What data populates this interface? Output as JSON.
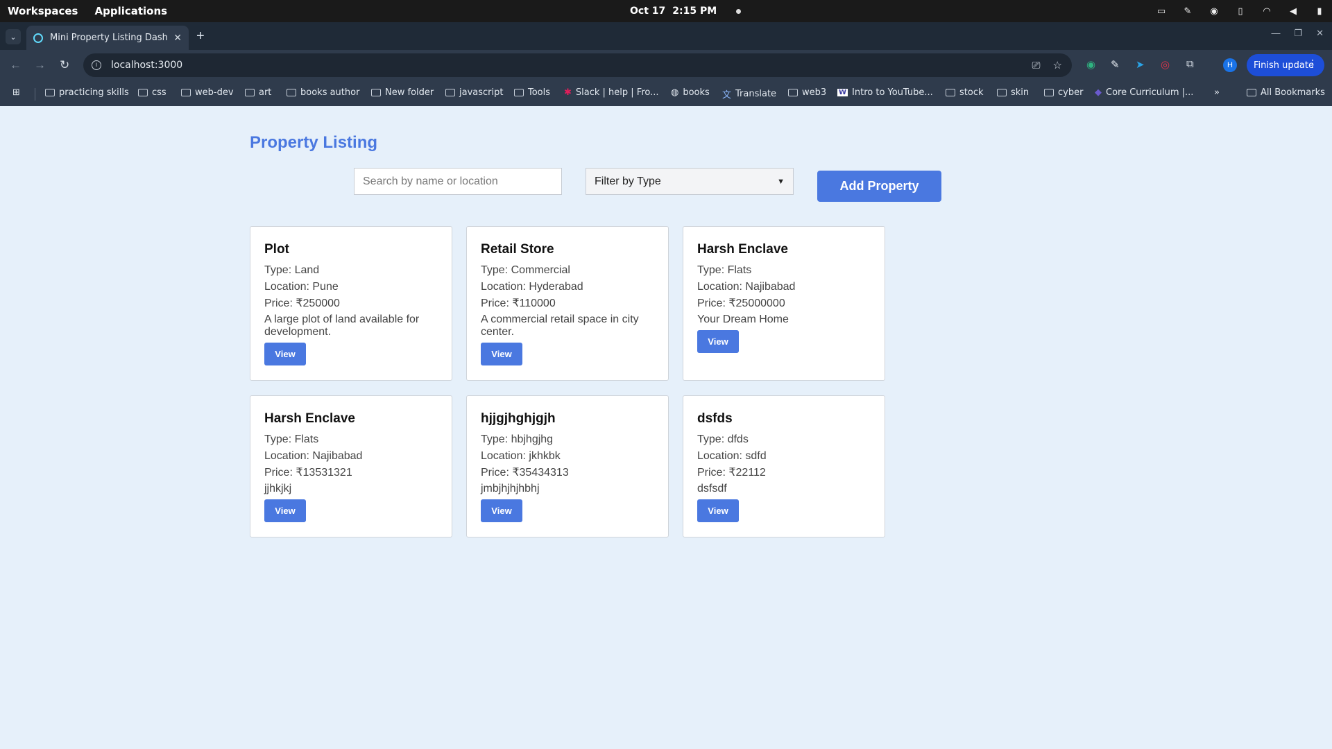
{
  "os": {
    "workspaces": "Workspaces",
    "applications": "Applications",
    "date": "Oct 17",
    "time": "2:15 PM"
  },
  "browser": {
    "tab_title": "Mini Property Listing Dashboard",
    "url": "localhost:3000",
    "avatar_letter": "H",
    "finish_update": "Finish update",
    "bookmarks": [
      "practicing skills",
      "css",
      "web-dev",
      "art",
      "books author",
      "New folder",
      "javascript",
      "Tools",
      "Slack | help | Fro...",
      "books",
      "Translate",
      "web3",
      "Intro to YouTube...",
      "stock",
      "skin",
      "cyber",
      "Core Curriculum |..."
    ],
    "all_bookmarks": "All Bookmarks"
  },
  "app": {
    "title": "Property Listing",
    "search_placeholder": "Search by name or location",
    "filter_label": "Filter by Type",
    "add_button": "Add Property",
    "view_label": "View",
    "properties": [
      {
        "name": "Plot",
        "type": "Type: Land",
        "location": "Location: Pune",
        "price": "Price: ₹250000",
        "description": "A large plot of land available for development."
      },
      {
        "name": "Retail Store",
        "type": "Type: Commercial",
        "location": "Location: Hyderabad",
        "price": "Price: ₹110000",
        "description": "A commercial retail space in city center."
      },
      {
        "name": "Harsh Enclave",
        "type": "Type: Flats",
        "location": "Location: Najibabad",
        "price": "Price: ₹25000000",
        "description": "Your Dream Home"
      },
      {
        "name": "Harsh Enclave",
        "type": "Type: Flats",
        "location": "Location: Najibabad",
        "price": "Price: ₹13531321",
        "description": "jjhkjkj"
      },
      {
        "name": "hjjgjhghjgjh",
        "type": "Type: hbjhgjhg",
        "location": "Location: jkhkbk",
        "price": "Price: ₹35434313",
        "description": "jmbjhjhjhbhj"
      },
      {
        "name": "dsfds",
        "type": "Type: dfds",
        "location": "Location: sdfd",
        "price": "Price: ₹22112",
        "description": "dsfsdf"
      }
    ]
  }
}
